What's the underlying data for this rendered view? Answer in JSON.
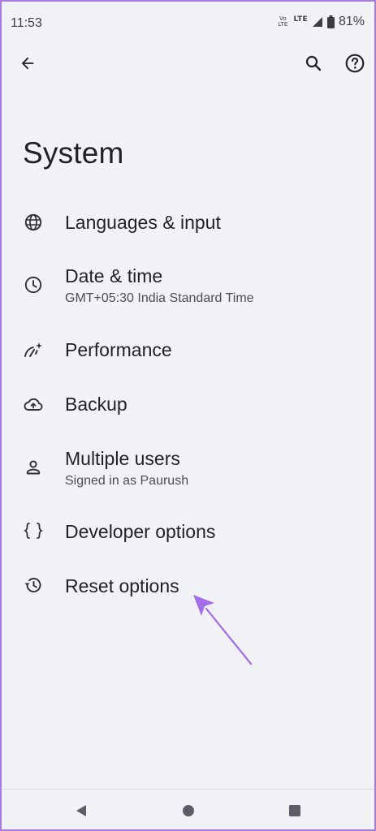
{
  "status_bar": {
    "time": "11:53",
    "volte_top": "Vo",
    "volte_bottom": "LTE",
    "network_label": "LTE",
    "battery_percent": "81%"
  },
  "top_bar": {
    "back_icon": "arrow-back-icon",
    "search_icon": "search-icon",
    "help_icon": "help-icon"
  },
  "page": {
    "title": "System"
  },
  "settings_items": [
    {
      "icon": "globe-icon",
      "title": "Languages & input",
      "subtitle": ""
    },
    {
      "icon": "clock-icon",
      "title": "Date & time",
      "subtitle": "GMT+05:30 India Standard Time"
    },
    {
      "icon": "performance-icon",
      "title": "Performance",
      "subtitle": ""
    },
    {
      "icon": "cloud-upload-icon",
      "title": "Backup",
      "subtitle": ""
    },
    {
      "icon": "person-icon",
      "title": "Multiple users",
      "subtitle": "Signed in as Paurush"
    },
    {
      "icon": "braces-icon",
      "title": "Developer options",
      "subtitle": ""
    },
    {
      "icon": "history-icon",
      "title": "Reset options",
      "subtitle": ""
    }
  ],
  "nav_bar": {
    "back": "triangle-back-icon",
    "home": "circle-home-icon",
    "recents": "square-recents-icon"
  },
  "colors": {
    "background": "#f1f2f6",
    "text_primary": "#1f2126",
    "text_secondary": "#4a4d55",
    "annotation_arrow": "#a46ee8",
    "frame_border": "#a77bd9"
  }
}
